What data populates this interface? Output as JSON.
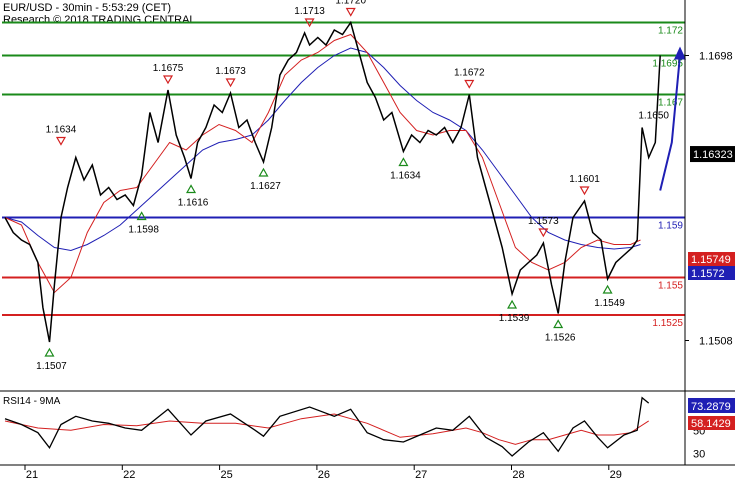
{
  "header": {
    "title": "EUR/USD - 30min - 5:53:29 (CET)",
    "subtitle": "Research © 2018 TRADING CENTRAL"
  },
  "chart_data": {
    "type": "line",
    "price_axis": {
      "ylim": [
        1.1475,
        1.1735
      ],
      "ticks": [
        "1.1698",
        "1.1508"
      ]
    },
    "x_axis": {
      "ticks": [
        "21",
        "22",
        "25",
        "26",
        "27",
        "28",
        "29"
      ]
    },
    "current_price": {
      "label": "1.16323",
      "value": 1.16323
    },
    "horizontal_levels": [
      {
        "label": "1.172",
        "value": 1.172,
        "color": "#1a8a1a"
      },
      {
        "label": "1.1695",
        "value": 1.1698,
        "color": "#1a8a1a"
      },
      {
        "label": "1.167",
        "value": 1.1672,
        "color": "#1a8a1a"
      },
      {
        "label": "1.159",
        "value": 1.159,
        "color": "#1f1fb4"
      },
      {
        "label": "1.155",
        "value": 1.155,
        "color": "#d42020"
      },
      {
        "label": "1.1525",
        "value": 1.1525,
        "color": "#d42020"
      }
    ],
    "ma_badges": [
      {
        "label": "1.15749",
        "color": "#d42020"
      },
      {
        "label": "1.1572",
        "color": "#1f1fb4"
      }
    ],
    "peaks": [
      {
        "label": "1.1634",
        "x": 3.4,
        "y": 1.1634
      },
      {
        "label": "1.1675",
        "x": 9.9,
        "y": 1.1675
      },
      {
        "label": "1.1673",
        "x": 13.7,
        "y": 1.1673
      },
      {
        "label": "1.1713",
        "x": 18.5,
        "y": 1.1713
      },
      {
        "label": "1.1720",
        "x": 21.0,
        "y": 1.172
      },
      {
        "label": "1.1672",
        "x": 28.2,
        "y": 1.1672
      },
      {
        "label": "1.1573",
        "x": 32.7,
        "y": 1.1573
      },
      {
        "label": "1.1601",
        "x": 35.2,
        "y": 1.1601
      }
    ],
    "troughs": [
      {
        "label": "1.1507",
        "x": 2.7,
        "y": 1.1507
      },
      {
        "label": "1.1598",
        "x": 8.3,
        "y": 1.1598
      },
      {
        "label": "1.1616",
        "x": 11.3,
        "y": 1.1616
      },
      {
        "label": "1.1627",
        "x": 15.7,
        "y": 1.1627
      },
      {
        "label": "1.1634",
        "x": 24.2,
        "y": 1.1634
      },
      {
        "label": "1.1539",
        "x": 30.8,
        "y": 1.1539
      },
      {
        "label": "1.1526",
        "x": 33.6,
        "y": 1.1526
      },
      {
        "label": "1.1549",
        "x": 36.6,
        "y": 1.1549
      }
    ],
    "extra_labels": [
      {
        "label": "1.1650",
        "x": 39.4,
        "y": 1.1656
      }
    ],
    "price": {
      "x": [
        0,
        0.5,
        1,
        1.5,
        2,
        2.3,
        2.7,
        3.0,
        3.4,
        3.8,
        4.3,
        4.8,
        5.3,
        5.8,
        6.3,
        6.8,
        7.3,
        7.8,
        8.3,
        8.8,
        9.3,
        9.9,
        10.4,
        10.9,
        11.3,
        11.7,
        12.2,
        12.7,
        13.2,
        13.7,
        14.2,
        14.7,
        15.2,
        15.7,
        16.2,
        16.7,
        17.2,
        17.7,
        18.2,
        18.5,
        19.0,
        19.5,
        20.0,
        20.5,
        21.0,
        21.5,
        22.0,
        22.5,
        23.0,
        23.5,
        24.2,
        24.7,
        25.2,
        25.7,
        26.2,
        26.7,
        27.2,
        27.7,
        28.2,
        28.7,
        29.2,
        29.7,
        30.2,
        30.8,
        31.3,
        31.8,
        32.3,
        32.7,
        33.2,
        33.6,
        34.0,
        34.5,
        35.2,
        35.7,
        36.2,
        36.6,
        37.1,
        37.6,
        38.1,
        38.4,
        38.7,
        39.1,
        39.5,
        39.8
      ],
      "y": [
        1.159,
        1.158,
        1.1575,
        1.1572,
        1.156,
        1.153,
        1.1507,
        1.1545,
        1.159,
        1.161,
        1.163,
        1.1615,
        1.1625,
        1.1605,
        1.161,
        1.1602,
        1.1605,
        1.1598,
        1.1618,
        1.166,
        1.164,
        1.1675,
        1.1645,
        1.163,
        1.1616,
        1.164,
        1.165,
        1.1665,
        1.166,
        1.1673,
        1.165,
        1.1655,
        1.164,
        1.1627,
        1.165,
        1.1685,
        1.1695,
        1.17,
        1.1713,
        1.1705,
        1.171,
        1.1705,
        1.1715,
        1.1712,
        1.172,
        1.17,
        1.168,
        1.167,
        1.1655,
        1.166,
        1.1634,
        1.1645,
        1.164,
        1.1648,
        1.1645,
        1.165,
        1.164,
        1.165,
        1.1672,
        1.163,
        1.161,
        1.159,
        1.157,
        1.1539,
        1.1555,
        1.156,
        1.1565,
        1.1573,
        1.1545,
        1.1526,
        1.156,
        1.159,
        1.1601,
        1.158,
        1.1575,
        1.1549,
        1.156,
        1.1565,
        1.157,
        1.1575,
        1.165,
        1.163,
        1.164,
        1.1698
      ]
    },
    "ma_red": {
      "x": [
        0,
        1,
        2,
        3,
        4,
        5,
        6,
        7,
        8,
        9,
        10,
        11,
        12,
        13,
        14,
        15,
        16,
        17,
        18,
        19,
        20,
        21,
        22,
        23,
        24,
        25,
        26,
        27,
        28,
        29,
        30,
        31,
        32,
        33,
        34,
        35,
        36,
        37,
        38,
        38.6
      ],
      "y": [
        1.159,
        1.1585,
        1.156,
        1.154,
        1.155,
        1.158,
        1.16,
        1.1608,
        1.161,
        1.1625,
        1.164,
        1.1635,
        1.1645,
        1.1652,
        1.1648,
        1.164,
        1.166,
        1.1685,
        1.1695,
        1.17,
        1.1708,
        1.1712,
        1.17,
        1.168,
        1.166,
        1.1648,
        1.1645,
        1.1648,
        1.1648,
        1.163,
        1.16,
        1.157,
        1.156,
        1.1555,
        1.156,
        1.157,
        1.1575,
        1.1572,
        1.1572,
        1.1575
      ]
    },
    "ma_blue": {
      "x": [
        0,
        1,
        2,
        3,
        4,
        5,
        6,
        7,
        8,
        9,
        10,
        11,
        12,
        13,
        14,
        15,
        16,
        17,
        18,
        19,
        20,
        21,
        22,
        23,
        24,
        25,
        26,
        27,
        28,
        29,
        30,
        31,
        32,
        33,
        34,
        35,
        36,
        37,
        38,
        38.6
      ],
      "y": [
        1.159,
        1.1587,
        1.1578,
        1.157,
        1.1568,
        1.1572,
        1.1578,
        1.1585,
        1.1595,
        1.1605,
        1.1615,
        1.1625,
        1.1635,
        1.164,
        1.1642,
        1.1645,
        1.1655,
        1.1668,
        1.168,
        1.169,
        1.1698,
        1.1703,
        1.17,
        1.169,
        1.1678,
        1.1668,
        1.166,
        1.1655,
        1.1648,
        1.1635,
        1.162,
        1.1605,
        1.159,
        1.158,
        1.1575,
        1.1572,
        1.157,
        1.1569,
        1.157,
        1.1572
      ]
    },
    "projection": {
      "x": [
        39.8,
        40.5,
        41.0
      ],
      "y": [
        1.1608,
        1.164,
        1.1698
      ]
    },
    "rsi": {
      "title": "RSI14 - 9MA",
      "ylim": [
        22,
        82
      ],
      "ticks": [
        "30",
        "50"
      ],
      "rsi_label": "73.2879",
      "ma_label": "58.1429",
      "rsi": {
        "x": [
          0,
          1,
          2,
          2.7,
          3.4,
          4.3,
          5.3,
          6.3,
          7.3,
          8.3,
          9.9,
          11.3,
          12.2,
          13.7,
          15.2,
          15.7,
          16.7,
          18.5,
          20.0,
          21.0,
          22.0,
          23.0,
          24.2,
          25.2,
          26.2,
          27.2,
          28.2,
          29.2,
          30.2,
          30.8,
          31.8,
          32.7,
          33.6,
          34.5,
          35.2,
          36.0,
          36.6,
          37.6,
          38.4,
          38.7,
          39.1
        ],
        "y": [
          60,
          55,
          48,
          35,
          55,
          62,
          58,
          56,
          52,
          50,
          68,
          46,
          58,
          64,
          50,
          45,
          62,
          70,
          62,
          68,
          48,
          42,
          40,
          46,
          52,
          50,
          62,
          44,
          36,
          28,
          40,
          48,
          32,
          52,
          58,
          44,
          35,
          46,
          50,
          78,
          73.3
        ]
      },
      "ma": {
        "x": [
          0,
          2,
          4,
          6,
          8,
          10,
          12,
          14,
          16,
          18,
          20,
          22,
          24,
          26,
          28,
          29,
          30,
          31,
          32,
          33,
          34,
          35,
          36,
          37,
          38,
          39.1
        ],
        "y": [
          58,
          52,
          50,
          55,
          54,
          58,
          56,
          56,
          52,
          60,
          64,
          56,
          44,
          47,
          52,
          48,
          42,
          38,
          42,
          42,
          46,
          50,
          46,
          46,
          48,
          58.1
        ]
      }
    }
  }
}
